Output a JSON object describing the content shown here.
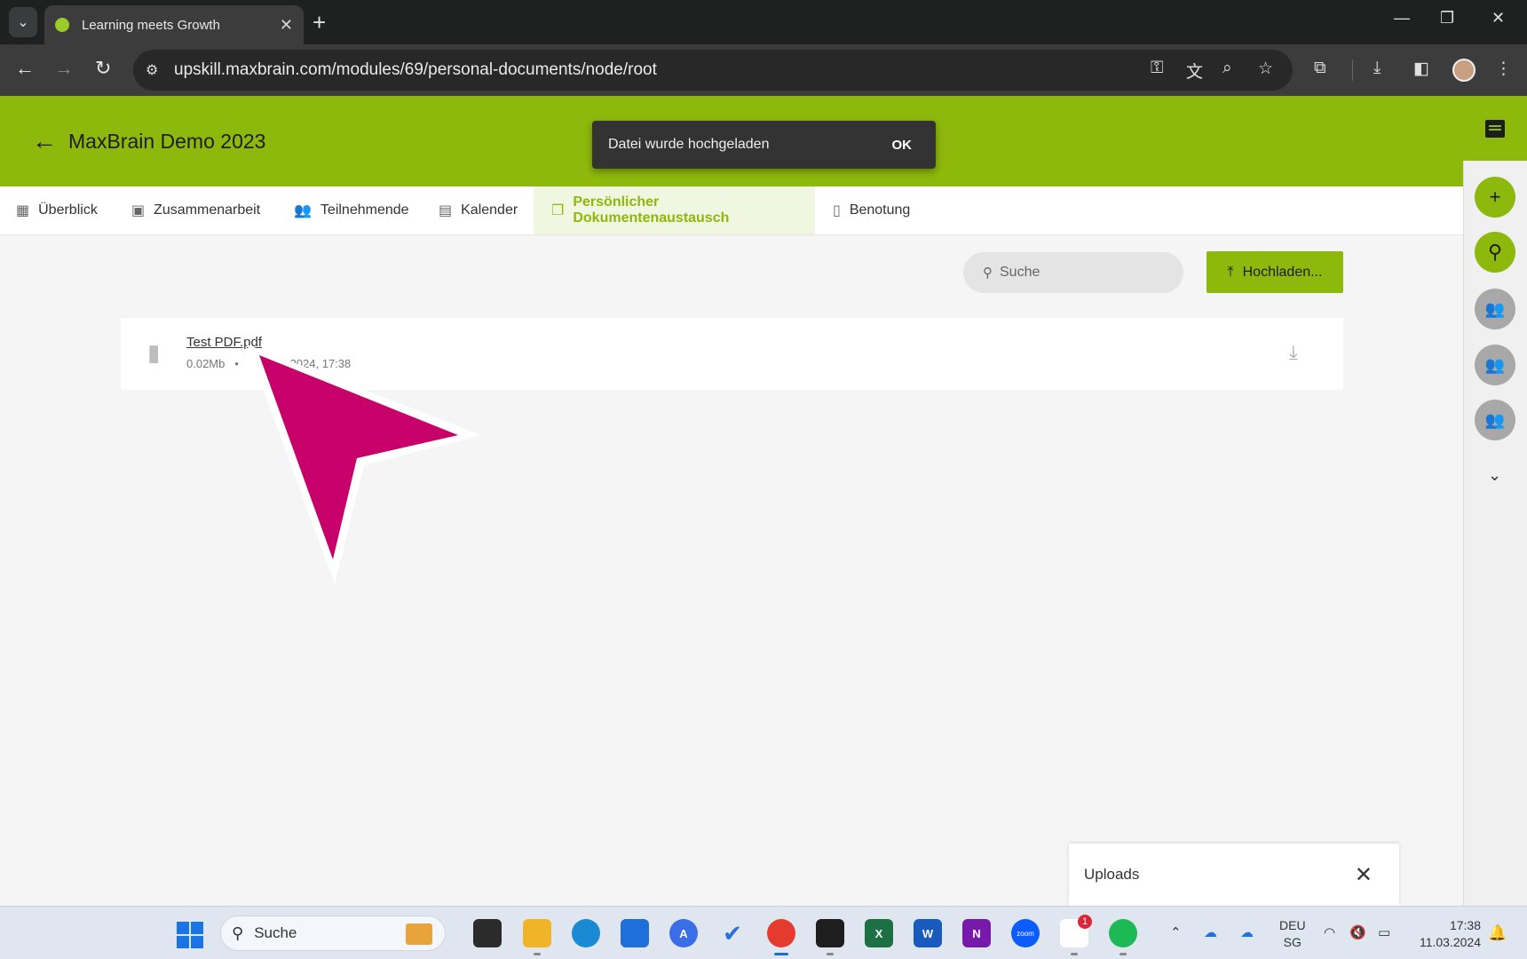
{
  "browser": {
    "tab_title": "Learning meets Growth",
    "url": "upskill.maxbrain.com/modules/69/personal-documents/node/root"
  },
  "header": {
    "course_title": "MaxBrain Demo 2023"
  },
  "snackbar": {
    "message": "Datei wurde hochgeladen",
    "action": "OK"
  },
  "tabs": [
    {
      "label": "Überblick",
      "icon": "dashboard-icon"
    },
    {
      "label": "Zusammenarbeit",
      "icon": "folder-shared-icon"
    },
    {
      "label": "Teilnehmende",
      "icon": "people-icon"
    },
    {
      "label": "Kalender",
      "icon": "calendar-icon"
    },
    {
      "label": "Persönlicher Dokumentenaustausch",
      "icon": "documents-icon",
      "active": true
    },
    {
      "label": "Benotung",
      "icon": "grading-icon"
    }
  ],
  "toolbar": {
    "search_placeholder": "Suche",
    "upload_label": "Hochladen..."
  },
  "files": [
    {
      "name": "Test PDF.pdf",
      "size": "0.02Mb",
      "date_fragment": "2024, 17:38"
    }
  ],
  "uploads_panel": {
    "title": "Uploads"
  },
  "taskbar": {
    "search_placeholder": "Suche",
    "slack_badge": "1",
    "language": "DEU",
    "keyboard": "SG",
    "time": "17:38",
    "date": "11.03.2024",
    "zoom_label": "zoom"
  },
  "colors": {
    "brand_green": "#8db80c",
    "cursor_annotation": "#c7006a"
  }
}
